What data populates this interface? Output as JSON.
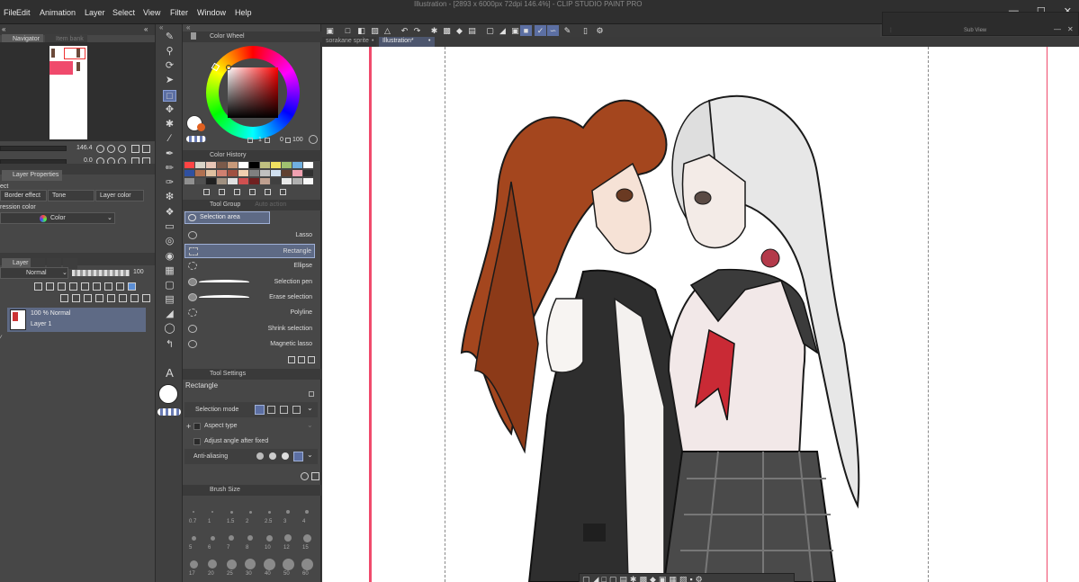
{
  "window": {
    "title_bar": "Illustration - [2893 x 6000px 72dpi 146.4%] - CLIP STUDIO PAINT PRO"
  },
  "menu": [
    "File",
    "Edit",
    "Animation",
    "Layer",
    "Select",
    "View",
    "Filter",
    "Window",
    "Help"
  ],
  "navigator": {
    "tab": "Navigator",
    "tab2": "Item bank",
    "zoom": "146.4",
    "rotation": "0.0"
  },
  "layer_properties": {
    "tab": "Layer Properties",
    "effect_label": "ect",
    "border_effect": "Border effect",
    "tone": "Tone",
    "layer_color": "Layer color",
    "expression_color_label": "ression color",
    "expression_color_value": "Color"
  },
  "layer_panel": {
    "tab": "Layer",
    "blend_mode": "Normal",
    "opacity": "100",
    "layers": [
      {
        "opacity_mode": "100 % Normal",
        "name": "Layer 1"
      }
    ]
  },
  "color_wheel": {
    "tab": "Color Wheel",
    "values": [
      "1",
      "0",
      "0",
      "100"
    ]
  },
  "color_history": {
    "tab": "Color History",
    "swatches": [
      "#ff4444",
      "#d9d4c8",
      "#e8c6b6",
      "#7a5a4a",
      "#c89a7a",
      "#ffffff",
      "#000000",
      "#c0c080",
      "#f0e060",
      "#a0c070",
      "#70b0e0",
      "#ffffff",
      "#3050a0",
      "#b07050",
      "#e0c0a0",
      "#d08070",
      "#a05040",
      "#f0d0b0",
      "#808080",
      "#c0c0c0",
      "#d0e0f0",
      "#604030",
      "#f0a0b0",
      "#303030",
      "#909090",
      "#505050",
      "#202020",
      "#a09080",
      "#e0e0e0",
      "#d05050",
      "#702020",
      "#c0a090",
      "#404040",
      "#e8e8e8",
      "#b0b0b0",
      "#f8f8f8"
    ]
  },
  "tool_group": {
    "tab": "Tool Group",
    "tab2": "Auto action",
    "current": "Selection area",
    "items": [
      "Lasso",
      "Rectangle",
      "Ellipse",
      "Selection pen",
      "Erase selection",
      "Polyline",
      "Shrink selection",
      "Magnetic lasso"
    ],
    "selected_index": 1
  },
  "tool_settings": {
    "tab": "Tool Settings",
    "tool_name": "Rectangle",
    "selection_mode": "Selection mode",
    "aspect_type": "Aspect type",
    "adjust_angle": "Adjust angle after fixed",
    "anti_aliasing": "Anti-aliasing"
  },
  "brush_size": {
    "tab": "Brush Size",
    "sizes": [
      "0.7",
      "1",
      "1.5",
      "2",
      "2.5",
      "3",
      "4",
      "5",
      "6",
      "7",
      "8",
      "10",
      "12",
      "15",
      "17",
      "20",
      "25",
      "30",
      "40",
      "50",
      "60"
    ]
  },
  "document_tabs": [
    "sorakane sprite",
    "Illustration*"
  ],
  "subview": {
    "title": "Sub View"
  },
  "colors": {
    "accent": "#5c6fa3",
    "guide_line": "#f04a6c",
    "panel_bg": "#474747",
    "menu_bg": "#2f2f2f"
  }
}
